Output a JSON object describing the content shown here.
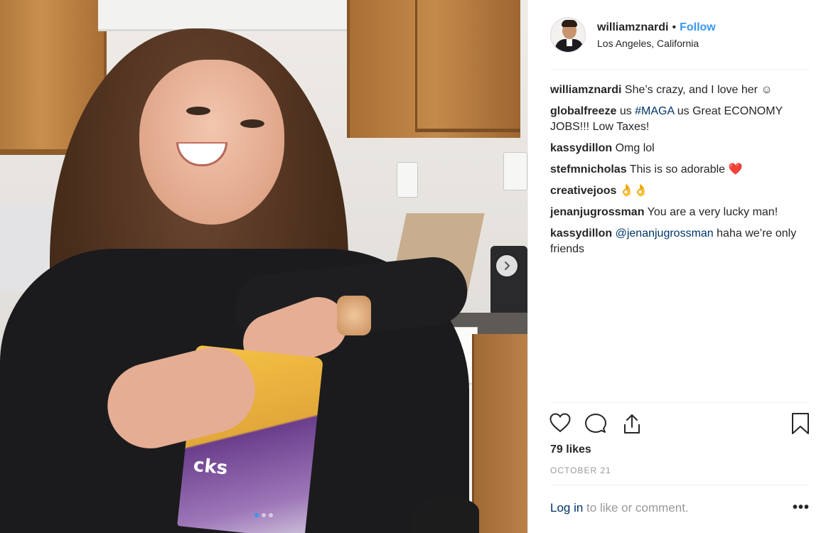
{
  "post": {
    "username": "williamznardi",
    "separator": "•",
    "follow_label": "Follow",
    "location": "Los Angeles, California",
    "carousel": {
      "slide_count": 3,
      "active_slide": 1
    },
    "photo_text": "cks"
  },
  "comments": [
    {
      "user": "williamznardi",
      "parts": [
        {
          "text": "She’s crazy, and I love her ☺",
          "tag": false
        }
      ]
    },
    {
      "user": "globalfreeze",
      "parts": [
        {
          "text": "us ",
          "tag": false
        },
        {
          "text": "#MAGA",
          "tag": true
        },
        {
          "text": " us Great ECONOMY JOBS!!! Low Taxes!",
          "tag": false
        }
      ]
    },
    {
      "user": "kassydillon",
      "parts": [
        {
          "text": "Omg lol",
          "tag": false
        }
      ]
    },
    {
      "user": "stefmnicholas",
      "parts": [
        {
          "text": "This is so adorable ❤️",
          "tag": false
        }
      ]
    },
    {
      "user": "creativejoos",
      "parts": [
        {
          "text": "👌👌",
          "tag": false
        }
      ]
    },
    {
      "user": "jenanjugrossman",
      "parts": [
        {
          "text": "You are a very lucky man!",
          "tag": false
        }
      ]
    },
    {
      "user": "kassydillon",
      "parts": [
        {
          "text": "@jenanjugrossman",
          "tag": true
        },
        {
          "text": " haha we’re only friends",
          "tag": false
        }
      ]
    }
  ],
  "actions": {
    "icons": [
      "heart-icon",
      "comment-icon",
      "share-icon",
      "bookmark-icon"
    ]
  },
  "likes_text": "79 likes",
  "date_text": "OCTOBER 21",
  "footer": {
    "login_label": "Log in",
    "login_suffix": " to like or comment.",
    "more_label": "•••"
  },
  "colors": {
    "link_blue": "#3897f0",
    "tag_blue": "#003569",
    "muted": "#999999",
    "text": "#262626"
  }
}
